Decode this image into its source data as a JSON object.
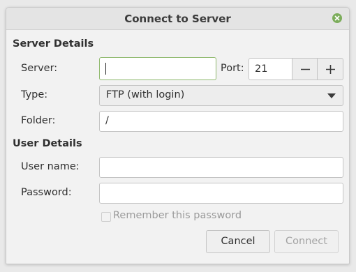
{
  "window": {
    "title": "Connect to Server"
  },
  "server_details": {
    "heading": "Server Details",
    "server_label": "Server:",
    "server_value": "",
    "port_label": "Port:",
    "port_value": "21",
    "type_label": "Type:",
    "type_value": "FTP (with login)",
    "folder_label": "Folder:",
    "folder_value": "/"
  },
  "user_details": {
    "heading": "User Details",
    "username_label": "User name:",
    "username_value": "",
    "password_label": "Password:",
    "password_value": "",
    "remember_label": "Remember this password",
    "remember_checked": false
  },
  "buttons": {
    "cancel": "Cancel",
    "connect": "Connect"
  },
  "icons": {
    "close": "close-icon",
    "minus": "minus-icon",
    "plus": "plus-icon",
    "dropdown": "chevron-down-icon"
  },
  "colors": {
    "close_button": "#7cad5b",
    "focus_border": "#8fb96d",
    "disabled_text": "#a3a3a3"
  }
}
